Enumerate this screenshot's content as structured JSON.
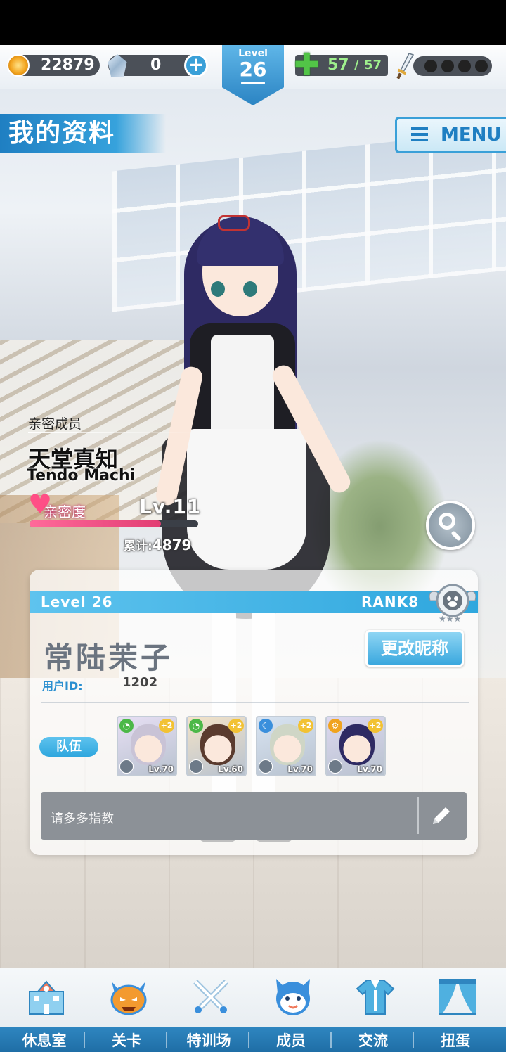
{
  "currency": {
    "coins": "22879",
    "gems": "0",
    "level_label": "Level",
    "level_value": "26",
    "stamina_current": "57",
    "stamina_sep": "/",
    "stamina_max": "57"
  },
  "header": {
    "title": "我的资料",
    "menu_label": "MENU"
  },
  "character": {
    "tag": "亲密成员",
    "name": "天堂真知",
    "romaji": "Tendo Machi",
    "intimacy_label": "亲密度",
    "intimacy_level": "Lv.11",
    "intimacy_progress": 0.78,
    "total_label": "累计:",
    "total_value": "4879"
  },
  "profile": {
    "level_text": "Level 26",
    "rank_text": "RANK8",
    "username": "常陆茉子",
    "uid_label": "用户ID:",
    "uid_value": "1202",
    "rename_button": "更改昵称",
    "team_label": "队伍",
    "team": [
      {
        "level": "Lv.70",
        "attr_color": "#4cb848",
        "portrait": "#c9c3d6",
        "bg": "#e7dff4"
      },
      {
        "level": "Lv.60",
        "attr_color": "#4cb848",
        "portrait": "#5a3b2e",
        "bg": "#f3e3c8"
      },
      {
        "level": "Lv.70",
        "attr_color": "#3a8fdc",
        "portrait": "#cfd6c6",
        "bg": "#d8e4f2"
      },
      {
        "level": "Lv.70",
        "attr_color": "#f0a31f",
        "portrait": "#2e2a63",
        "bg": "#ddd8f0"
      }
    ],
    "bonus_label": "+2",
    "message": "请多多指教"
  },
  "nav": [
    {
      "label": "休息室",
      "icon": "school-building-icon"
    },
    {
      "label": "关卡",
      "icon": "demon-face-icon"
    },
    {
      "label": "特训场",
      "icon": "crossed-swords-icon"
    },
    {
      "label": "成员",
      "icon": "cat-mascot-icon"
    },
    {
      "label": "交流",
      "icon": "uniform-icon"
    },
    {
      "label": "扭蛋",
      "icon": "curtain-stage-icon"
    }
  ],
  "colors": {
    "accent": "#2fa7de",
    "intimacy": "#ff4f86",
    "stamina": "#9ff08d"
  }
}
